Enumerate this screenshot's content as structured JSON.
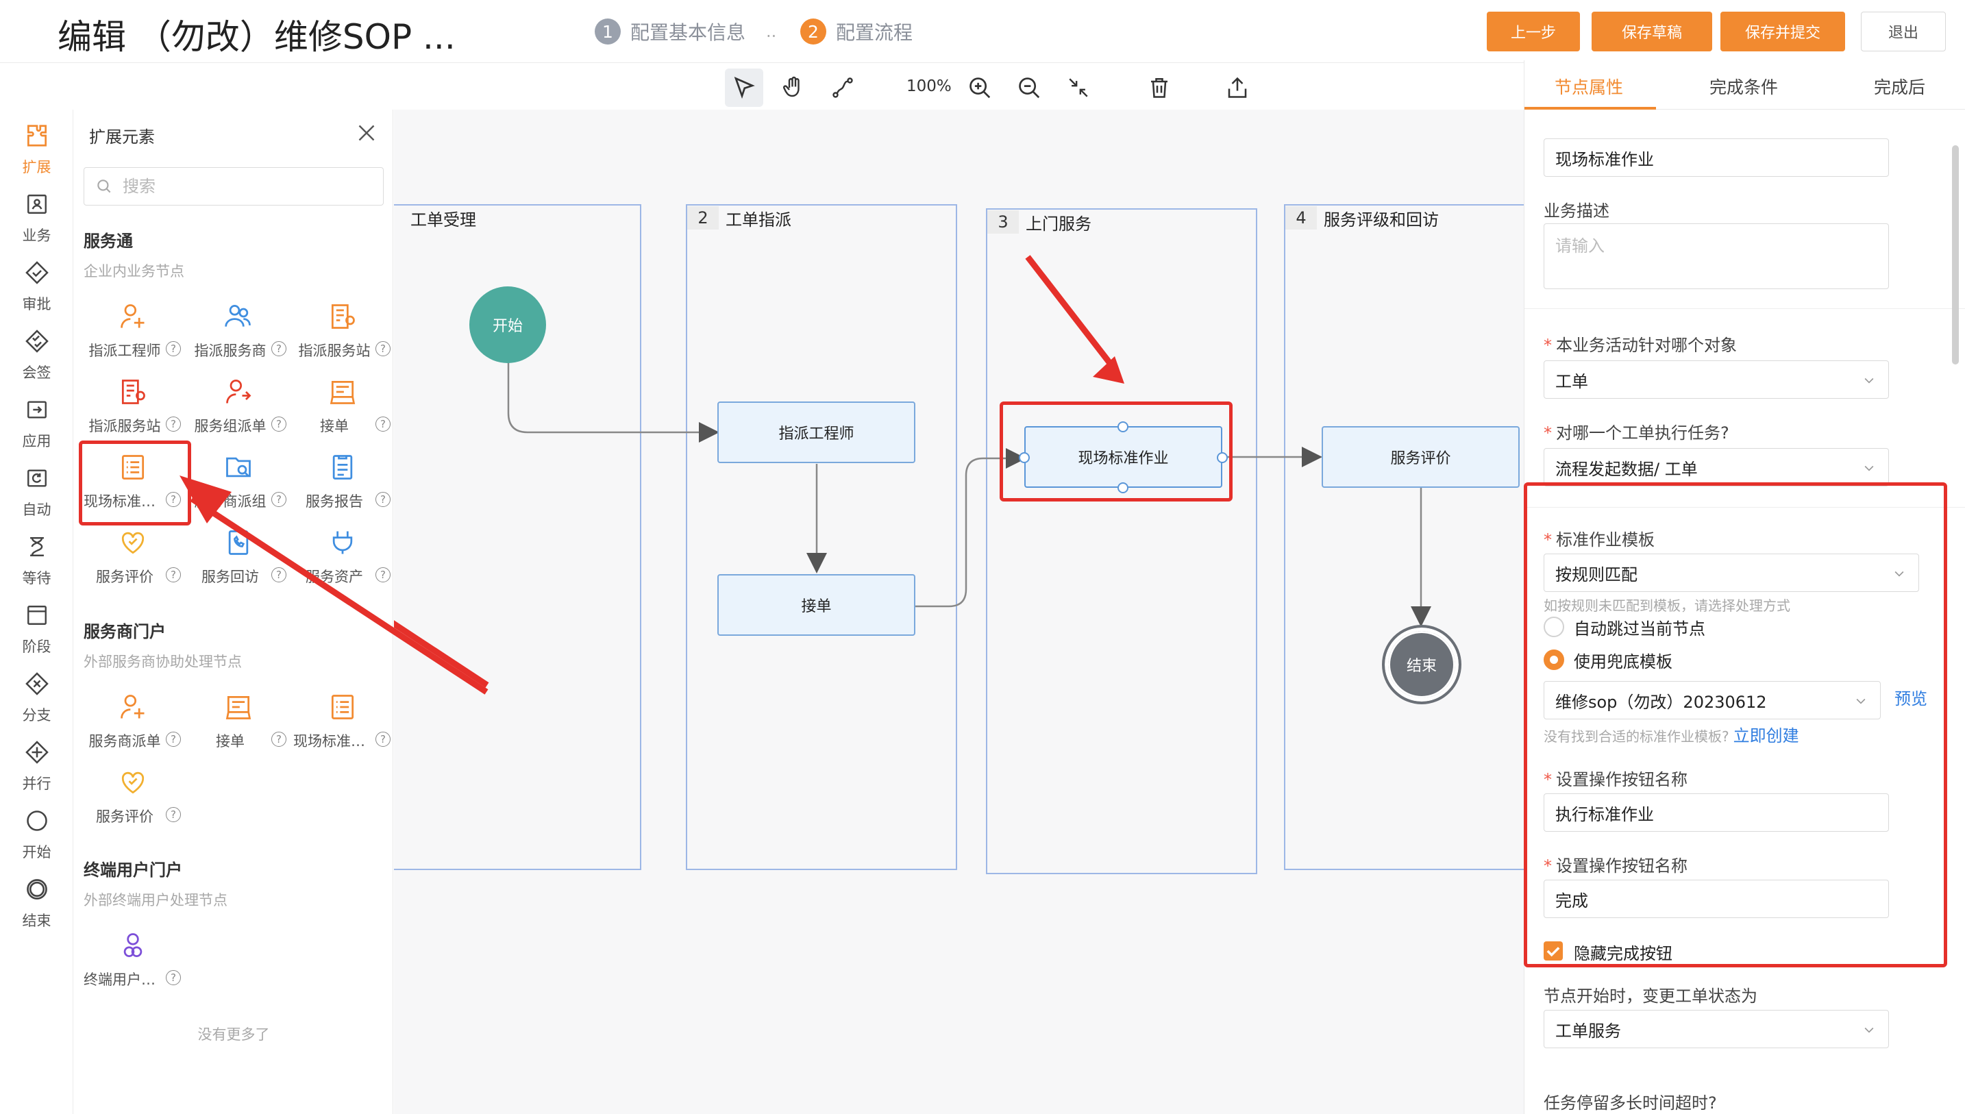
{
  "header": {
    "title": "编辑 （勿改）维修SOP ...",
    "steps": [
      {
        "num": "1",
        "label": "配置基本信息",
        "color": "#9aa1ad"
      },
      {
        "num": "2",
        "label": "配置流程",
        "color": "#f28a30"
      }
    ],
    "step_sep": "..",
    "buttons": {
      "prev": "上一步",
      "save_draft": "保存草稿",
      "save_submit": "保存并提交",
      "exit": "退出"
    }
  },
  "toolbar": {
    "zoom": "100%"
  },
  "rail": [
    {
      "label": "扩展",
      "icon": "puzzle-icon"
    },
    {
      "label": "业务",
      "icon": "business-icon"
    },
    {
      "label": "审批",
      "icon": "approval-icon"
    },
    {
      "label": "会签",
      "icon": "countersign-icon"
    },
    {
      "label": "应用",
      "icon": "app-icon"
    },
    {
      "label": "自动",
      "icon": "auto-icon"
    },
    {
      "label": "等待",
      "icon": "hourglass-icon"
    },
    {
      "label": "阶段",
      "icon": "stage-icon"
    },
    {
      "label": "分支",
      "icon": "branch-icon"
    },
    {
      "label": "并行",
      "icon": "parallel-icon"
    },
    {
      "label": "开始",
      "icon": "start-icon"
    },
    {
      "label": "结束",
      "icon": "end-icon"
    }
  ],
  "panel": {
    "title": "扩展元素",
    "search_placeholder": "搜索",
    "sections": [
      {
        "title": "服务通",
        "subtitle": "企业内业务节点",
        "items": [
          "指派工程师",
          "指派服务商",
          "指派服务站",
          "指派服务站",
          "服务组派单",
          "接单",
          "现场标准作业",
          "服务商派组",
          "服务报告",
          "服务评价",
          "服务回访",
          "服务资产"
        ]
      },
      {
        "title": "服务商门户",
        "subtitle": "外部服务商协助处理节点",
        "items": [
          "服务商派单",
          "接单",
          "现场标准作业",
          "服务评价"
        ]
      },
      {
        "title": "终端用户门户",
        "subtitle": "外部终端用户处理节点",
        "items": [
          "终端用户评价"
        ]
      }
    ],
    "no_more": "没有更多了"
  },
  "canvas": {
    "lanes": [
      {
        "num": "",
        "title": "工单受理"
      },
      {
        "num": "2",
        "title": "工单指派"
      },
      {
        "num": "3",
        "title": "上门服务"
      },
      {
        "num": "4",
        "title": "服务评级和回访"
      }
    ],
    "nodes": {
      "start": "开始",
      "assign": "指派工程师",
      "accept": "接单",
      "onsite": "现场标准作业",
      "eval": "服务评价",
      "end": "结束"
    }
  },
  "right_panel": {
    "tabs": [
      "节点属性",
      "完成条件",
      "完成后"
    ],
    "node_name": "现场标准作业",
    "desc_label": "业务描述",
    "desc_placeholder": "请输入",
    "target_label": "本业务活动针对哪个对象",
    "target_value": "工单",
    "which_label": "对哪一个工单执行任务?",
    "which_value": "流程发起数据/ 工单",
    "template_label": "标准作业模板",
    "template_value": "按规则匹配",
    "template_hint": "如按规则未匹配到模板，请选择处理方式",
    "radio_skip": "自动跳过当前节点",
    "radio_default": "使用兜底模板",
    "default_template": "维修sop（勿改）20230612",
    "preview": "预览",
    "no_template_hint": "没有找到合适的标准作业模板?",
    "create_now": "立即创建",
    "btn_name_label1": "设置操作按钮名称",
    "btn_name_value1": "执行标准作业",
    "btn_name_label2": "设置操作按钮名称",
    "btn_name_value2": "完成",
    "hide_complete": "隐藏完成按钮",
    "status_label": "节点开始时，变更工单状态为",
    "status_value": "工单服务",
    "timeout_label": "任务停留多长时间超时?"
  },
  "colors": {
    "accent": "#f28a30",
    "highlight": "#e5302a",
    "start_node": "#4dab9e",
    "end_node": "#6b7077"
  }
}
